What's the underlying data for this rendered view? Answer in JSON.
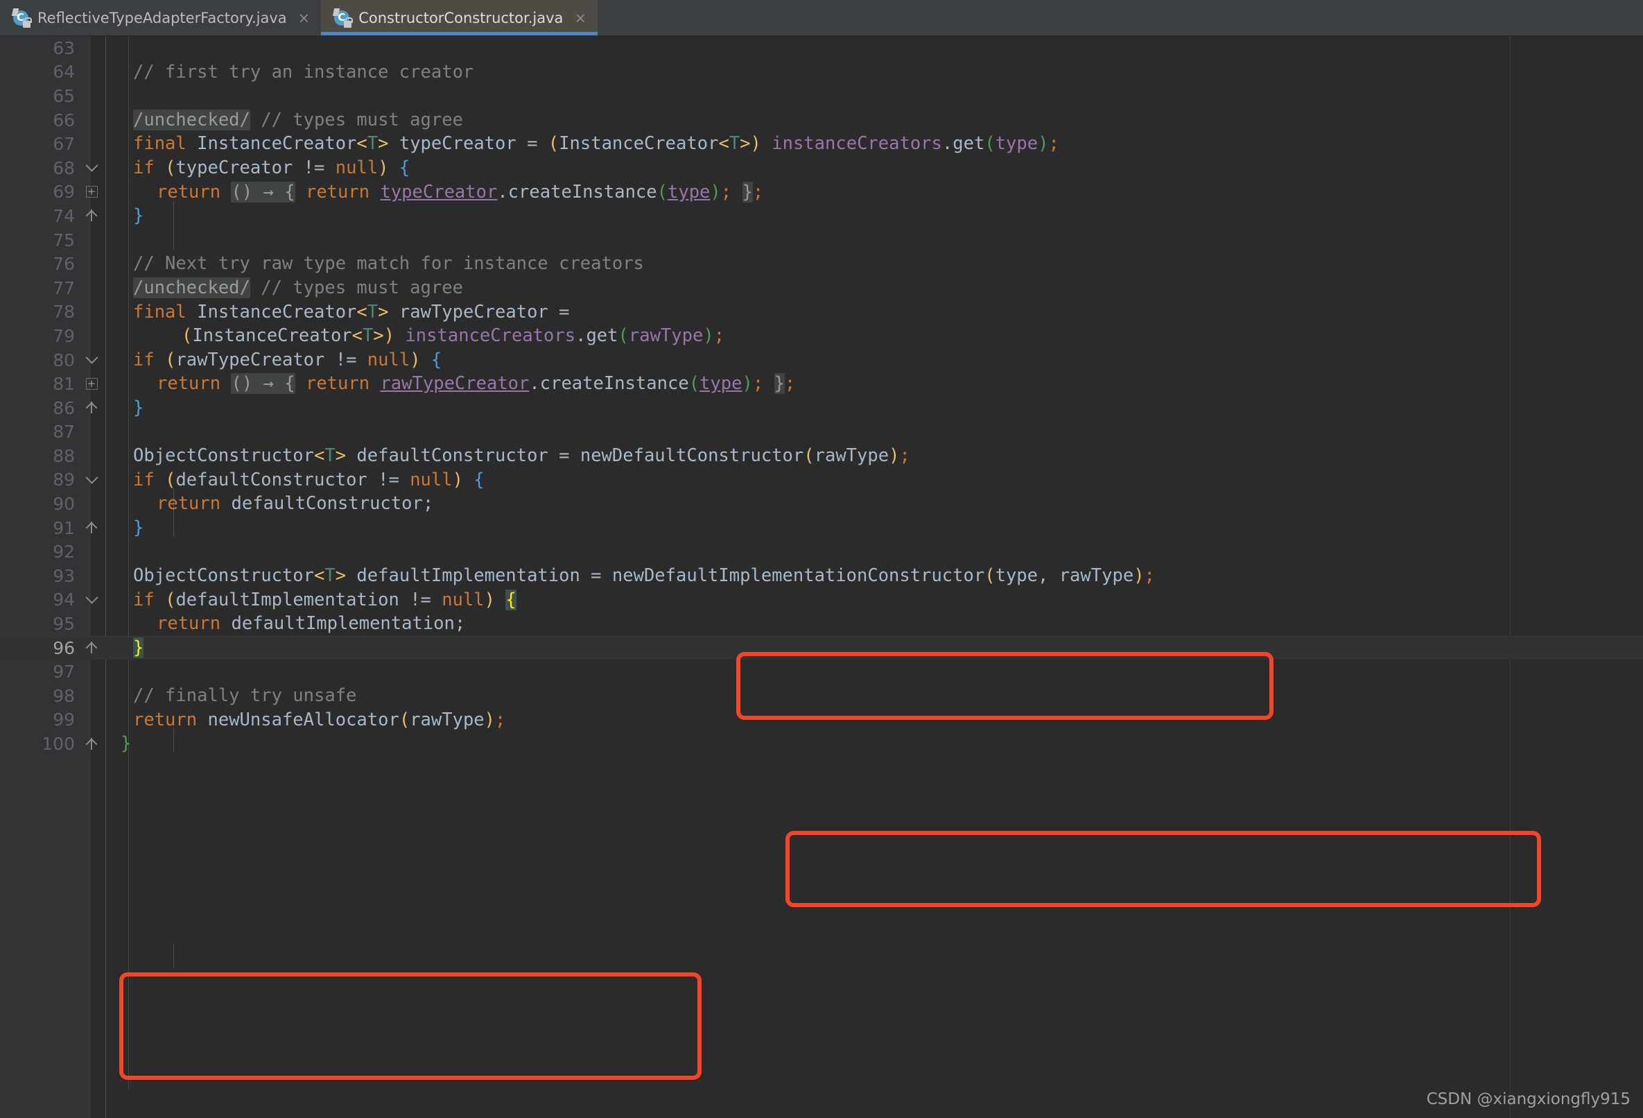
{
  "window": {
    "theme_bg": "#2b2b2b",
    "gutter_bg": "#313335",
    "accent": "#4a88c7",
    "annotation_color": "#f4452a"
  },
  "tabbar": {
    "tabs": [
      {
        "label": "ReflectiveTypeAdapterFactory.java",
        "icon": "java-class-icon",
        "close_label": "×",
        "active": false
      },
      {
        "label": "ConstructorConstructor.java",
        "icon": "java-class-icon",
        "close_label": "×",
        "active": true
      }
    ]
  },
  "editor": {
    "language": "java",
    "caret_line": "96",
    "lines": [
      {
        "num": "63",
        "fold": "",
        "text": ""
      },
      {
        "num": "64",
        "fold": "",
        "text": "    // first try an instance creator"
      },
      {
        "num": "65",
        "fold": "",
        "text": ""
      },
      {
        "num": "66",
        "fold": "",
        "text": "    /unchecked/ // types must agree"
      },
      {
        "num": "67",
        "fold": "",
        "text": "    final InstanceCreator<T> typeCreator = (InstanceCreator<T>) instanceCreators.get(type);"
      },
      {
        "num": "68",
        "fold": "collapse-arrow",
        "text": "    if (typeCreator != null) {"
      },
      {
        "num": "69",
        "fold": "expand-box",
        "text": "      return () -> { return typeCreator.createInstance(type); };"
      },
      {
        "num": "74",
        "fold": "fold-end",
        "text": "    }"
      },
      {
        "num": "75",
        "fold": "",
        "text": ""
      },
      {
        "num": "76",
        "fold": "",
        "text": "    // Next try raw type match for instance creators"
      },
      {
        "num": "77",
        "fold": "",
        "text": "    /unchecked/ // types must agree"
      },
      {
        "num": "78",
        "fold": "",
        "text": "    final InstanceCreator<T> rawTypeCreator ="
      },
      {
        "num": "79",
        "fold": "",
        "text": "        (InstanceCreator<T>) instanceCreators.get(rawType);"
      },
      {
        "num": "80",
        "fold": "collapse-arrow",
        "text": "    if (rawTypeCreator != null) {"
      },
      {
        "num": "81",
        "fold": "expand-box",
        "text": "      return () -> { return rawTypeCreator.createInstance(type); };"
      },
      {
        "num": "86",
        "fold": "fold-end",
        "text": "    }"
      },
      {
        "num": "87",
        "fold": "",
        "text": ""
      },
      {
        "num": "88",
        "fold": "",
        "text": "    ObjectConstructor<T> defaultConstructor = newDefaultConstructor(rawType);"
      },
      {
        "num": "89",
        "fold": "collapse-arrow",
        "text": "    if (defaultConstructor != null) {"
      },
      {
        "num": "90",
        "fold": "",
        "text": "      return defaultConstructor;"
      },
      {
        "num": "91",
        "fold": "fold-end",
        "text": "    }"
      },
      {
        "num": "92",
        "fold": "",
        "text": ""
      },
      {
        "num": "93",
        "fold": "",
        "text": "    ObjectConstructor<T> defaultImplementation = newDefaultImplementationConstructor(type, rawType);"
      },
      {
        "num": "94",
        "fold": "collapse-arrow",
        "text": "    if (defaultImplementation != null) {"
      },
      {
        "num": "95",
        "fold": "",
        "text": "      return defaultImplementation;"
      },
      {
        "num": "96",
        "fold": "fold-end",
        "text": "    }"
      },
      {
        "num": "97",
        "fold": "",
        "text": ""
      },
      {
        "num": "98",
        "fold": "",
        "text": "    // finally try unsafe"
      },
      {
        "num": "99",
        "fold": "",
        "text": "    return newUnsafeAllocator(rawType);"
      },
      {
        "num": "100",
        "fold": "fold-end",
        "text": "  }"
      }
    ],
    "tokens": {
      "line64_comment": "// first try an instance creator",
      "line66_fold": "/unchecked/",
      "line66_comment": "// types must agree",
      "line67_final": "final",
      "line67_type": "InstanceCreator",
      "line67_generic": "T",
      "line67_var": " typeCreator = ",
      "line67_cast_type": "InstanceCreator",
      "line67_field": "instanceCreators",
      "line67_call": ".get",
      "line67_arg": "type",
      "line68_if": "if",
      "line68_cond": "typeCreator != ",
      "line68_null": "null",
      "line69_return": "return",
      "line69_lambda": "() → {",
      "line69_return2": "return",
      "line69_recv": "typeCreator",
      "line69_method": ".createInstance",
      "line69_arg": "type",
      "line69_foldclose": "}",
      "line76_comment": "// Next try raw type match for instance creators",
      "line77_fold": "/unchecked/",
      "line77_comment": "// types must agree",
      "line78_var": " rawTypeCreator =",
      "line79_field": "instanceCreators",
      "line79_arg": "rawType",
      "line80_cond": "rawTypeCreator != ",
      "line81_recv": "rawTypeCreator",
      "line88_type": "ObjectConstructor",
      "line88_var": " defaultConstructor = ",
      "line88_call": "newDefaultConstructor",
      "line88_arg": "rawType",
      "line89_cond": "defaultConstructor != ",
      "line90_ret": "defaultConstructor;",
      "line93_var": " defaultImplementation = ",
      "line93_call": "newDefaultImplementationConstructor",
      "line93_args": "type, rawType",
      "line94_cond": "defaultImplementation != ",
      "line95_ret": "defaultImplementation;",
      "line98_comment": "// finally try unsafe",
      "line99_call": "newUnsafeAllocator",
      "line99_arg": "rawType"
    }
  },
  "annotations": {
    "boxes": [
      {
        "name": "highlight-newDefaultConstructor",
        "label": "newDefaultConstructor(rawType);"
      },
      {
        "name": "highlight-newDefaultImplementationConstructor",
        "label": "newDefaultImplementationConstructor(type, rawType);"
      },
      {
        "name": "highlight-finally-try-unsafe",
        "label": "// finally try unsafe / return newUnsafeAllocator(rawType);"
      }
    ]
  },
  "watermark": {
    "site": "CSDN",
    "author": "@xiangxiongfly915"
  }
}
